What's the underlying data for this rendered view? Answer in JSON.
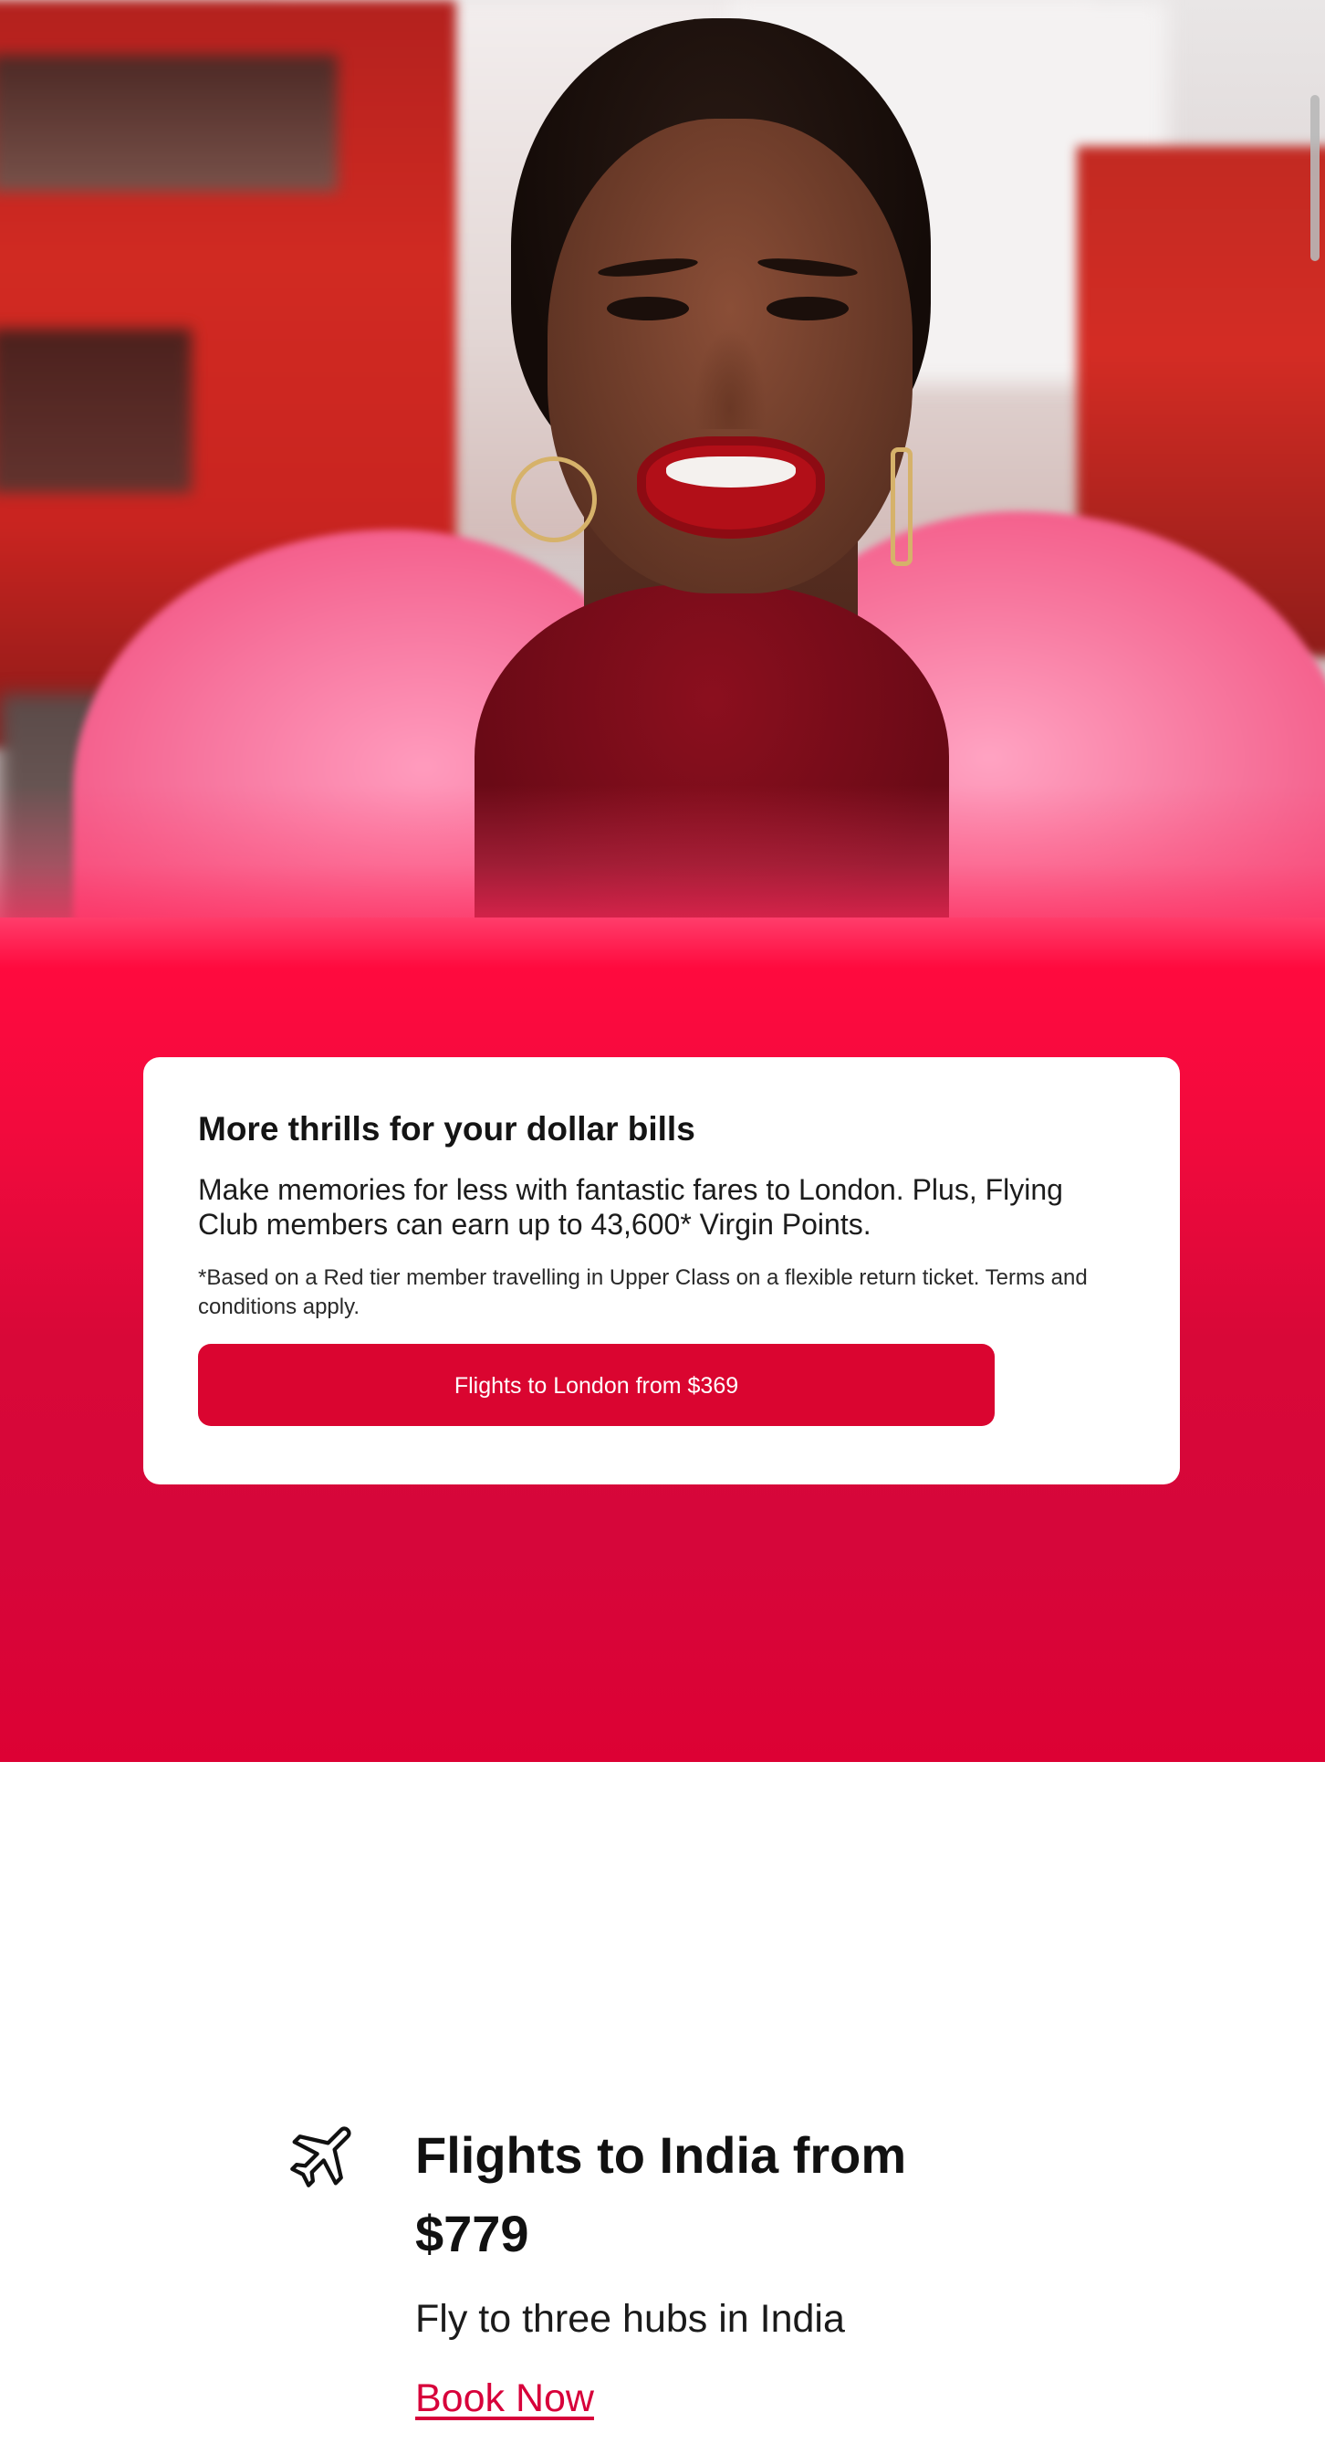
{
  "hero": {
    "image_alt": "Smiling woman in a pink faux-fur coat on a London street"
  },
  "promo": {
    "title": "More thrills for your dollar bills",
    "body": "Make memories for less with fantastic fares to London. Plus, Flying Club members can earn up to 43,600* Virgin Points.",
    "footnote": "*Based on a Red tier member travelling in Upper Class on a flexible return ticket. Terms and conditions apply.",
    "button_label": "Flights to London from $369"
  },
  "india": {
    "icon": "airplane-icon",
    "title": "Flights to India from $779",
    "subtitle": "Fly to three hubs in India",
    "link_label": "Book Now"
  },
  "colors": {
    "brand_red": "#da0530",
    "link_red": "#d7003a",
    "card_bg": "#ffffff",
    "text_dark": "#111111"
  }
}
